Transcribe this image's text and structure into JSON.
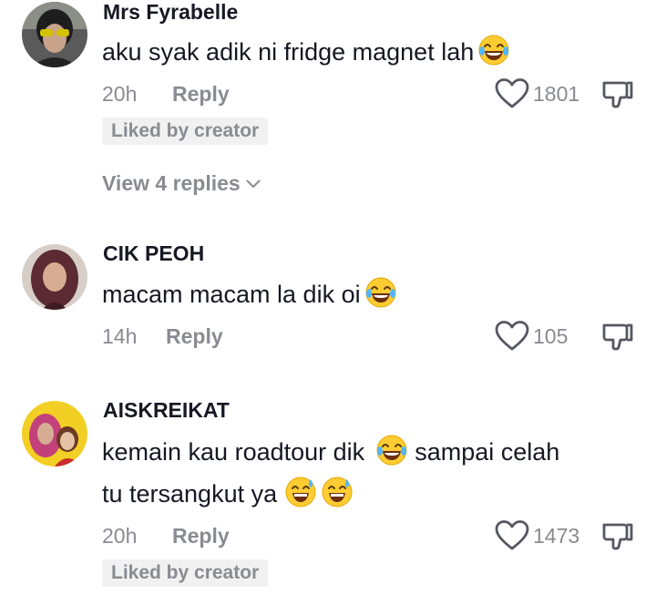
{
  "comments": [
    {
      "username": "Mrs Fyrabelle",
      "text": "aku syak adik ni fridge magnet lah",
      "time": "20h",
      "reply_label": "Reply",
      "likes": "1801",
      "badge": "Liked by creator",
      "view_replies": "View 4 replies"
    },
    {
      "username": "CIK PEOH",
      "text": "macam macam la dik oi",
      "time": "14h",
      "reply_label": "Reply",
      "likes": "105"
    },
    {
      "username": "AISKREIKAT",
      "text_line1": "kemain kau roadtour dik",
      "text_line1_after": "sampai celah",
      "text_line2": "tu tersangkut ya",
      "time": "20h",
      "reply_label": "Reply",
      "likes": "1473",
      "badge": "Liked by creator"
    }
  ],
  "icons": {
    "like": "heart-outline-icon",
    "dislike": "thumbs-down-icon",
    "laugh": "face-with-tears-of-joy-emoji",
    "sweat": "grinning-face-with-sweat-emoji",
    "chevron": "chevron-down-icon"
  },
  "colors": {
    "text": "#161823",
    "muted": "#8a8b91",
    "badge_bg": "#f1f1f2",
    "background": "#ffffff"
  }
}
